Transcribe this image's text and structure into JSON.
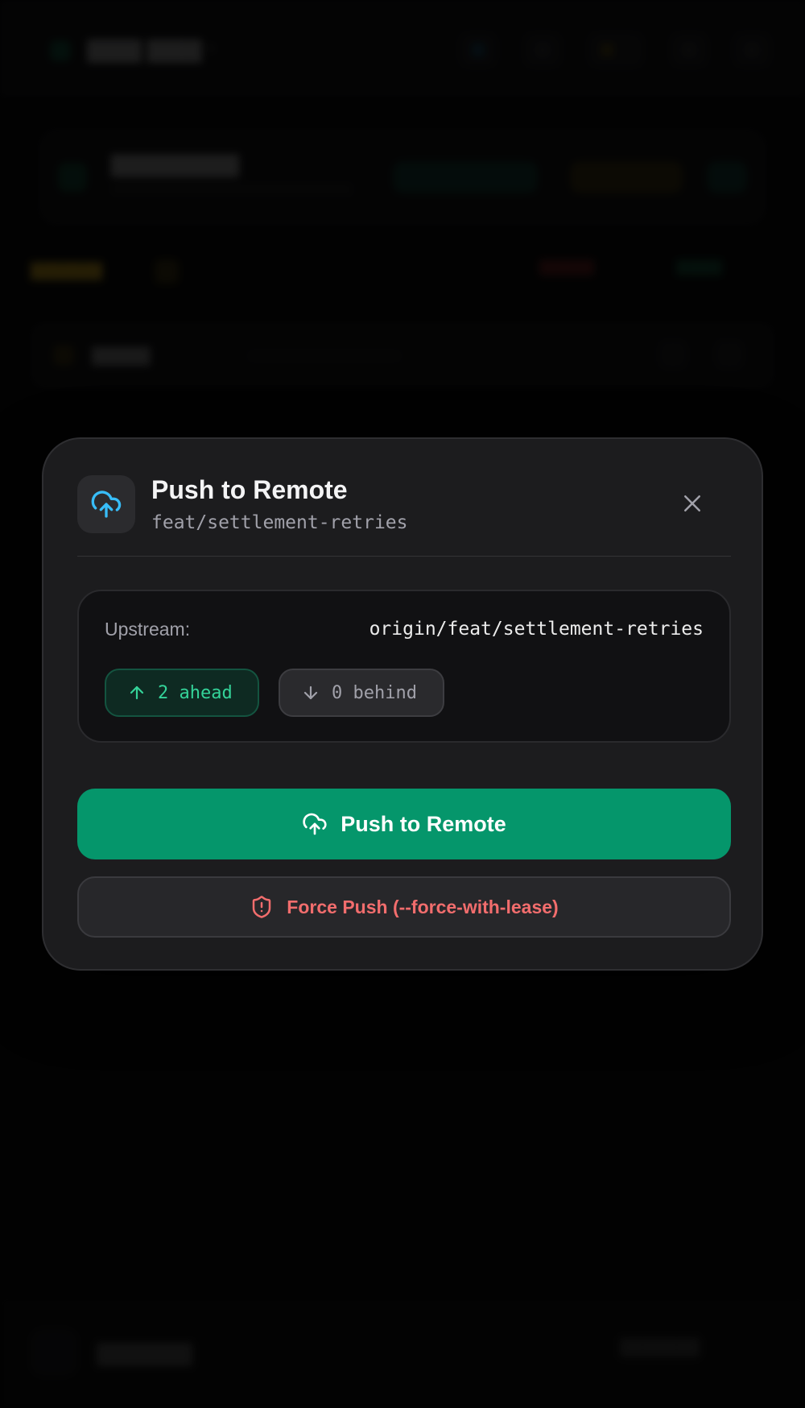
{
  "modal": {
    "title": "Push to Remote",
    "branch": "feat/settlement-retries",
    "upstream_label": "Upstream:",
    "upstream_value": "origin/feat/settlement-retries",
    "ahead_label": "2 ahead",
    "behind_label": "0 behind",
    "push_button_label": "Push to Remote",
    "force_push_button_label": "Force Push (--force-with-lease)",
    "icons": {
      "header": "cloud-upload-icon",
      "close": "close-icon",
      "ahead": "arrow-up-icon",
      "behind": "arrow-down-icon",
      "push": "cloud-upload-icon",
      "force": "shield-alert-icon"
    }
  },
  "colors": {
    "accent_green": "#05966b",
    "ahead_text": "#34d399",
    "danger_text": "#f26d6d",
    "icon_blue": "#38bdf8",
    "modal_bg": "#1c1c1e"
  }
}
